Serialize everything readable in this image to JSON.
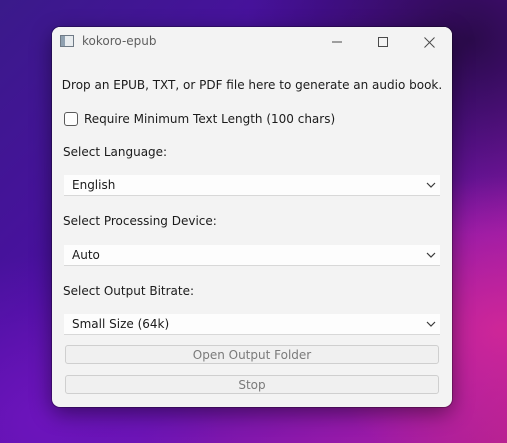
{
  "window": {
    "title": "kokoro-epub"
  },
  "main": {
    "drop_hint": "Drop an EPUB, TXT, or PDF file here to generate an audio book.",
    "min_length_checkbox": {
      "label": "Require Minimum Text Length (100 chars)",
      "checked": false
    },
    "language": {
      "label": "Select Language:",
      "value": "English"
    },
    "device": {
      "label": "Select Processing Device:",
      "value": "Auto"
    },
    "bitrate": {
      "label": "Select Output Bitrate:",
      "value": "Small Size (64k)"
    },
    "open_folder_button": "Open Output Folder",
    "stop_button": "Stop"
  },
  "icons": {
    "app": "app-window-icon",
    "minimize": "minimize-icon",
    "maximize": "maximize-icon",
    "close": "close-icon",
    "dropdown": "chevron-down-icon"
  },
  "colors": {
    "window_background": "#f3f3f3",
    "field_background": "#fdfdfd",
    "text": "#1b1b1b",
    "disabled_text": "#7a7a7a"
  }
}
